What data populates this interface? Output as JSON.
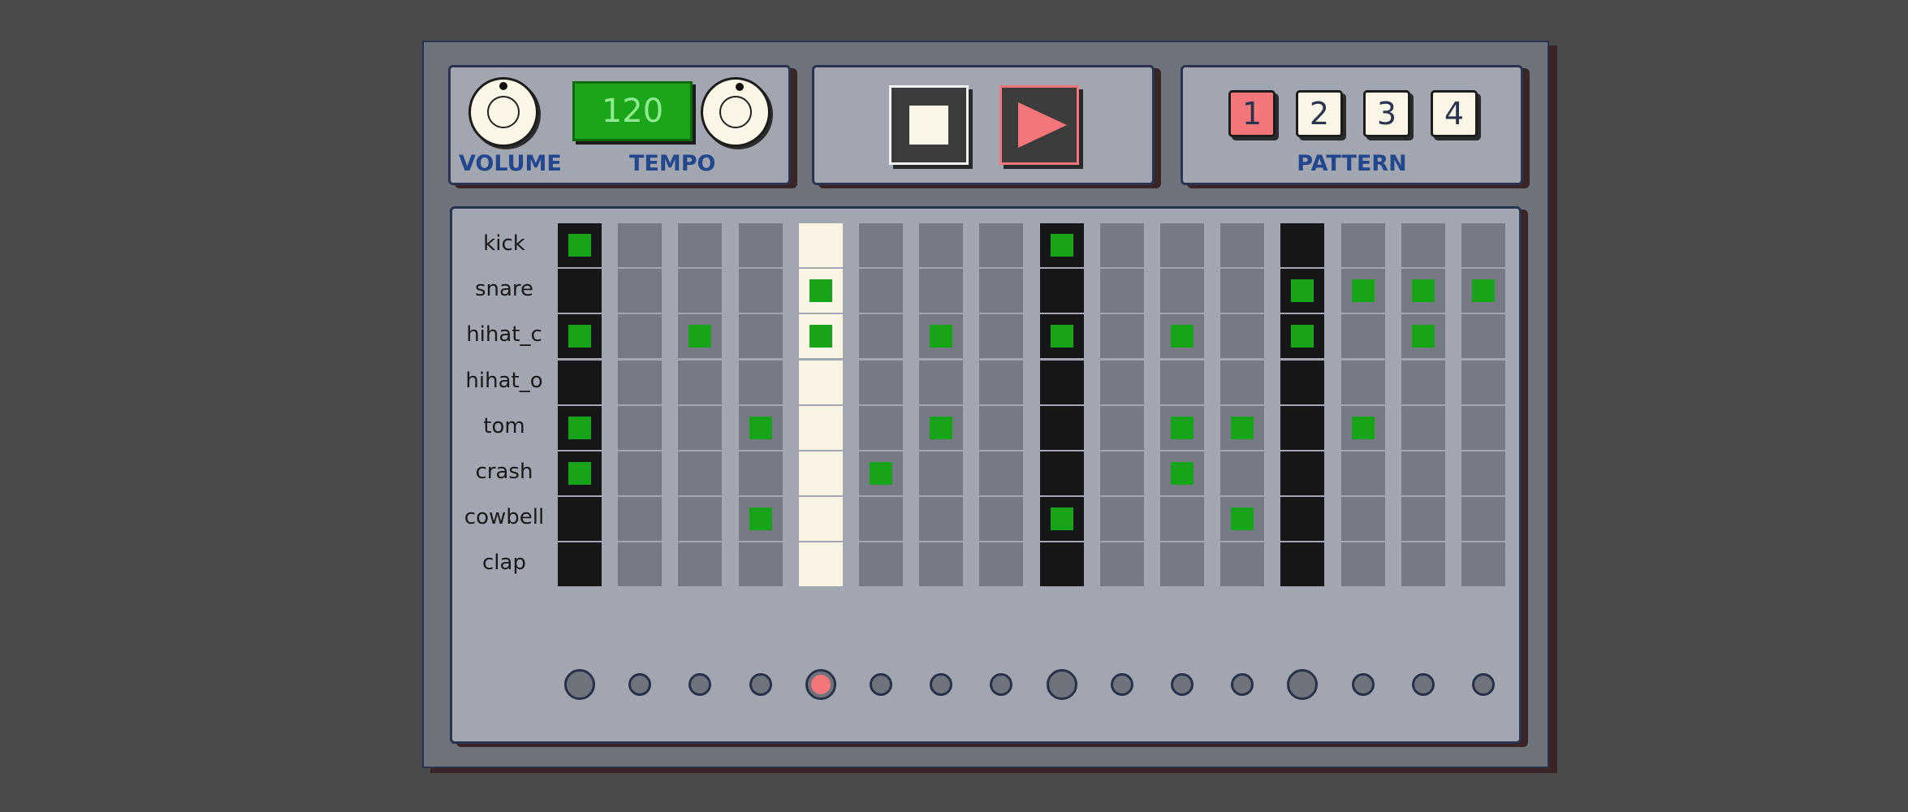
{
  "controls": {
    "volume_label": "VOLUME",
    "tempo_label": "TEMPO",
    "tempo_value": "120",
    "volume_level": 0,
    "tempo_knob": 0.5
  },
  "transport": {
    "stop_icon": "stop-icon",
    "play_icon": "play-icon",
    "playing": true
  },
  "pattern": {
    "label": "PATTERN",
    "buttons": [
      "1",
      "2",
      "3",
      "4"
    ],
    "selected": "1"
  },
  "sequencer": {
    "current_step": 5,
    "accent_steps": [
      1,
      9,
      13
    ],
    "rows": [
      {
        "name": "kick",
        "steps": [
          1,
          9
        ]
      },
      {
        "name": "snare",
        "steps": [
          5,
          13,
          14,
          15,
          16
        ]
      },
      {
        "name": "hihat_c",
        "steps": [
          1,
          3,
          5,
          7,
          9,
          11,
          13,
          15
        ]
      },
      {
        "name": "hihat_o",
        "steps": []
      },
      {
        "name": "tom",
        "steps": [
          1,
          4,
          7,
          11,
          12,
          14
        ]
      },
      {
        "name": "crash",
        "steps": [
          1,
          6,
          11
        ]
      },
      {
        "name": "cowbell",
        "steps": [
          4,
          9,
          12
        ]
      },
      {
        "name": "clap",
        "steps": []
      }
    ]
  },
  "colors": {
    "note_on": "#18a419",
    "accent_column": "#161718",
    "current_column": "#f9f4e3",
    "cell_off": "#757a84",
    "led_active": "#f2767a",
    "label_blue": "#22478c",
    "panel": "#a1a6b1"
  }
}
